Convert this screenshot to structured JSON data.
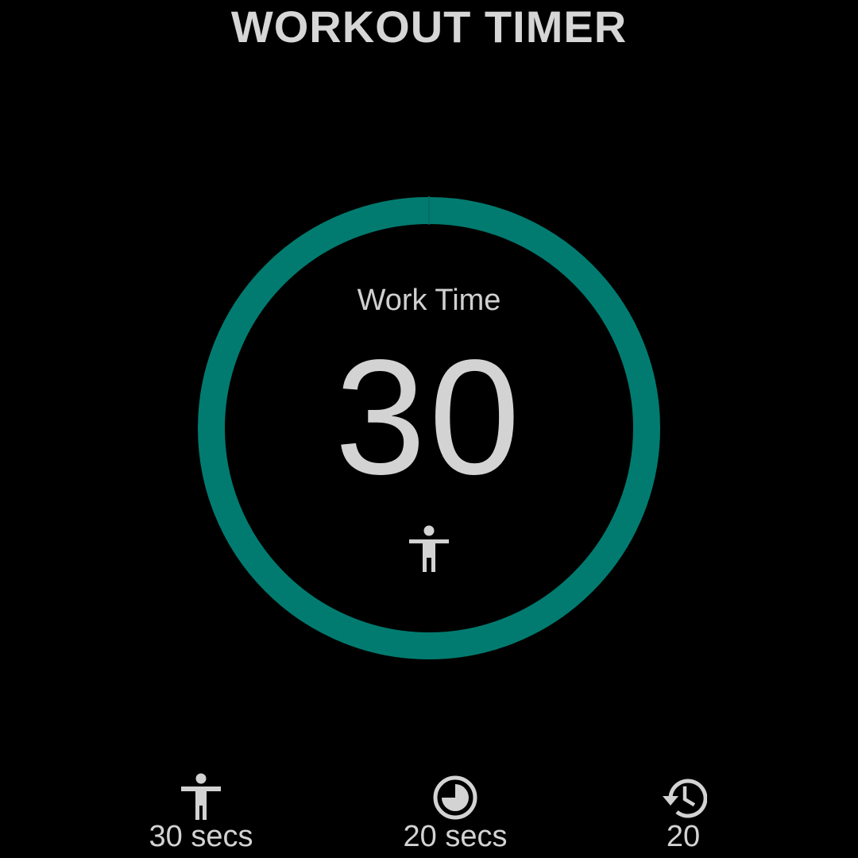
{
  "app": {
    "title": "WORKOUT TIMER"
  },
  "timer": {
    "phase_label": "Work Time",
    "countdown": "30",
    "progress": 1.0,
    "phase_icon": "person-arms-out-icon"
  },
  "stats": {
    "work": {
      "icon": "person-arms-out-icon",
      "value": "30 secs"
    },
    "rest": {
      "icon": "clock-pie-icon",
      "value": "20 secs"
    },
    "rounds": {
      "icon": "history-icon",
      "value": "20"
    }
  },
  "colors": {
    "background": "#000000",
    "ring": "#017b70",
    "text": "#d3d3d3"
  }
}
